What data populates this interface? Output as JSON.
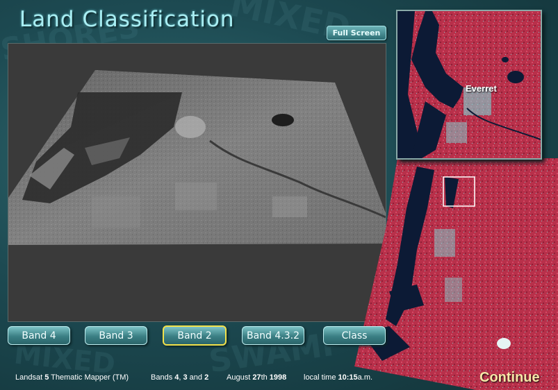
{
  "app": {
    "title": "Land Classification",
    "full_screen_label": "Full Screen",
    "continue_label": "Continue"
  },
  "inset": {
    "location_label": "Everret"
  },
  "bands": [
    {
      "label": "Band 4",
      "active": false
    },
    {
      "label": "Band 3",
      "active": false
    },
    {
      "label": "Band 2",
      "active": true
    },
    {
      "label": "Band 4.3.2",
      "active": false
    },
    {
      "label": "Class",
      "active": false
    }
  ],
  "footer": {
    "sensor_prefix": "Landsat ",
    "sensor_number": "5",
    "sensor_suffix": " Thematic Mapper (TM)",
    "bands_prefix": "Bands ",
    "band_a": "4",
    "band_sep1": ", ",
    "band_b": "3",
    "band_sep2": " and ",
    "band_c": "2",
    "date_prefix": "August ",
    "date_day": "27",
    "date_mid": "th ",
    "date_year": "1998",
    "time_prefix": "local time ",
    "time_value": "10:15",
    "time_suffix": "a.m."
  },
  "colors": {
    "accent": "#a9eef3",
    "active_border": "#f2e14a",
    "continue_text": "#f6e7a8",
    "vegetation_red": "#c7364f",
    "water": "#0c1a35",
    "urban_cyan": "#7fd6d6"
  }
}
